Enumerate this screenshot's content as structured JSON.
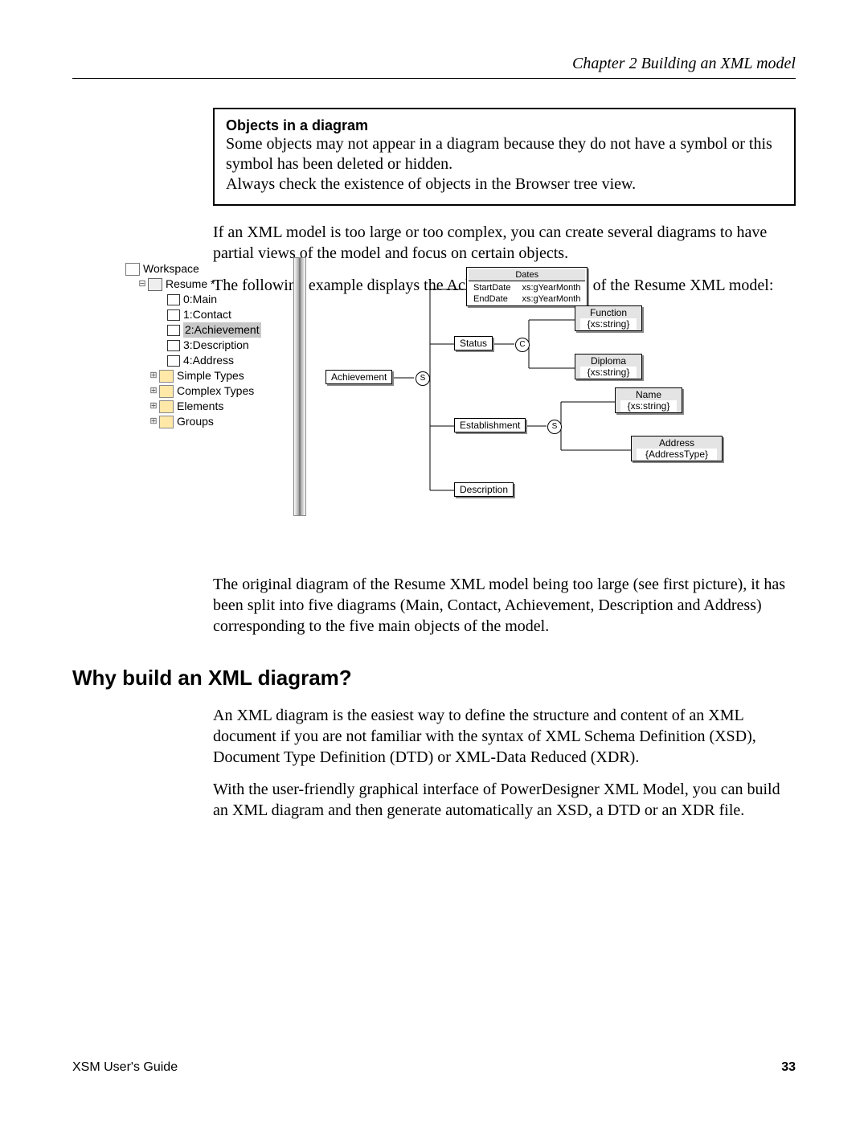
{
  "header": "Chapter 2  Building an XML model",
  "note": {
    "title": "Objects in a diagram",
    "line1": "Some objects may not appear in a diagram because they do not have a symbol or this symbol has been deleted or hidden.",
    "line2": "Always check the existence of objects in the Browser tree view."
  },
  "p1": "If an XML model is too large or too complex, you can create several diagrams to have partial views of the model and focus on certain objects.",
  "p2": "The following example displays the Achievement diagram of the Resume XML model:",
  "tree": {
    "workspace": "Workspace",
    "resume": "Resume *",
    "d0": "0:Main",
    "d1": "1:Contact",
    "d2": "2:Achievement",
    "d3": "3:Description",
    "d4": "4:Address",
    "f1": "Simple Types",
    "f2": "Complex Types",
    "f3": "Elements",
    "f4": "Groups"
  },
  "diagram": {
    "dates_h": "Dates",
    "dates_r1a": "StartDate",
    "dates_r1b": "xs:gYearMonth",
    "dates_r2a": "EndDate",
    "dates_r2b": "xs:gYearMonth",
    "status": "Status",
    "achievement": "Achievement",
    "establishment": "Establishment",
    "description": "Description",
    "s": "S",
    "c": "C",
    "function_h": "Function",
    "function_t": "{xs:string}",
    "diploma_h": "Diploma",
    "diploma_t": "{xs:string}",
    "name_h": "Name",
    "name_t": "{xs:string}",
    "address_h": "Address",
    "address_t": "{AddressType}"
  },
  "p3": "The original diagram of the Resume XML model being too large (see first picture), it has been split into five diagrams (Main, Contact, Achievement, Description and Address) corresponding to the five main objects of the model.",
  "h2": "Why build an XML diagram?",
  "p4": "An XML diagram is the easiest way to define the structure and content of an XML document if you are not familiar with the syntax of XML Schema Definition (XSD), Document Type Definition (DTD) or XML-Data Reduced (XDR).",
  "p5": "With the user-friendly graphical interface of PowerDesigner XML Model, you can build an XML diagram and then generate automatically an XSD, a DTD or an XDR file.",
  "footer": {
    "left": "XSM User's Guide",
    "page": "33"
  }
}
